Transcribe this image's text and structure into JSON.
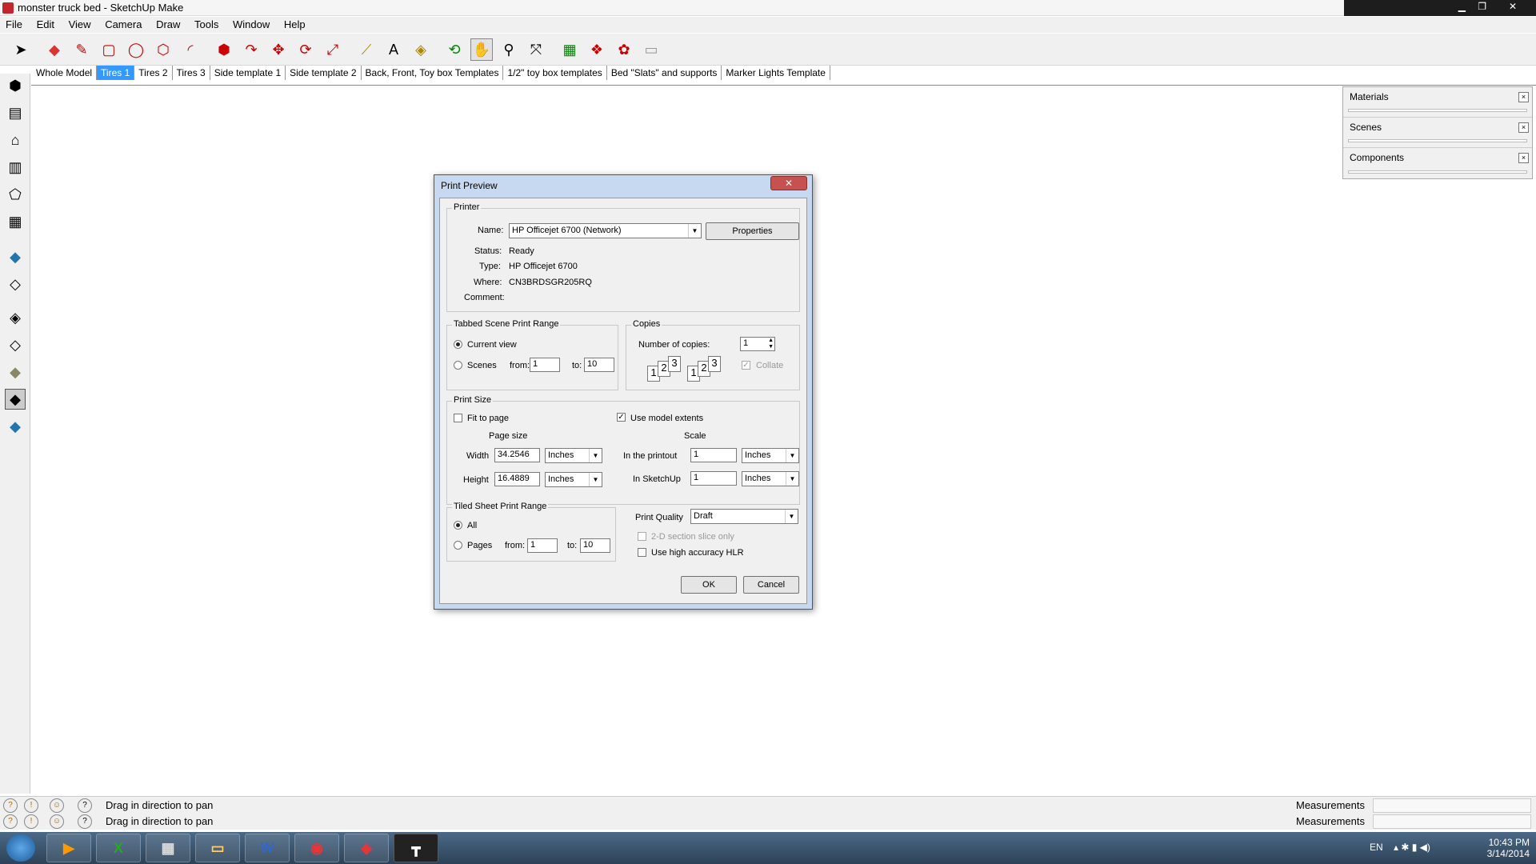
{
  "window": {
    "title": "monster truck bed - SketchUp Make"
  },
  "menu": [
    "File",
    "Edit",
    "View",
    "Camera",
    "Draw",
    "Tools",
    "Window",
    "Help"
  ],
  "scene_tabs": [
    {
      "label": "Whole Model",
      "active": false
    },
    {
      "label": "Tires 1",
      "active": true
    },
    {
      "label": "Tires 2",
      "active": false
    },
    {
      "label": "Tires 3",
      "active": false
    },
    {
      "label": "Side template 1",
      "active": false
    },
    {
      "label": "Side template 2",
      "active": false
    },
    {
      "label": "Back, Front, Toy box Templates",
      "active": false
    },
    {
      "label": "1/2\" toy box templates",
      "active": false
    },
    {
      "label": "Bed \"Slats\" and supports",
      "active": false
    },
    {
      "label": "Marker Lights Template",
      "active": false
    }
  ],
  "tray": {
    "panels": [
      "Materials",
      "Scenes",
      "Components"
    ]
  },
  "dialog": {
    "title": "Print Preview",
    "close": "✕",
    "printer": {
      "group": "Printer",
      "name_label": "Name:",
      "name_value": "HP Officejet 6700 (Network)",
      "properties": "Properties",
      "status_label": "Status:",
      "status_value": "Ready",
      "type_label": "Type:",
      "type_value": "HP Officejet 6700",
      "where_label": "Where:",
      "where_value": "CN3BRDSGR205RQ",
      "comment_label": "Comment:"
    },
    "scene_range": {
      "group": "Tabbed Scene Print Range",
      "current_view": "Current view",
      "scenes": "Scenes",
      "from_label": "from:",
      "from_value": "1",
      "to_label": "to:",
      "to_value": "10"
    },
    "copies": {
      "group": "Copies",
      "number_label": "Number of copies:",
      "number_value": "1",
      "collate": "Collate",
      "collate_digits": [
        "1",
        "2",
        "3"
      ]
    },
    "print_size": {
      "group": "Print Size",
      "fit_to_page": "Fit to page",
      "use_model_extents": "Use model extents",
      "page_size": "Page size",
      "scale": "Scale",
      "width_label": "Width",
      "width_value": "34.2546",
      "width_unit": "Inches",
      "height_label": "Height",
      "height_value": "16.4889",
      "height_unit": "Inches",
      "printout_label": "In the printout",
      "printout_value": "1",
      "printout_unit": "Inches",
      "sketchup_label": "In SketchUp",
      "sketchup_value": "1",
      "sketchup_unit": "Inches"
    },
    "tiled": {
      "group": "Tiled Sheet Print Range",
      "all": "All",
      "pages": "Pages",
      "from_label": "from:",
      "from_value": "1",
      "to_label": "to:",
      "to_value": "10"
    },
    "quality": {
      "label": "Print Quality",
      "value": "Draft",
      "section_slice": "2-D section slice only",
      "high_accuracy": "Use high accuracy HLR"
    },
    "ok": "OK",
    "cancel": "Cancel"
  },
  "status": {
    "hint": "Drag in direction to pan",
    "measurements": "Measurements"
  },
  "taskbar": {
    "lang": "EN",
    "time": "10:43 PM",
    "date": "3/14/2014",
    "word_label": "W"
  }
}
